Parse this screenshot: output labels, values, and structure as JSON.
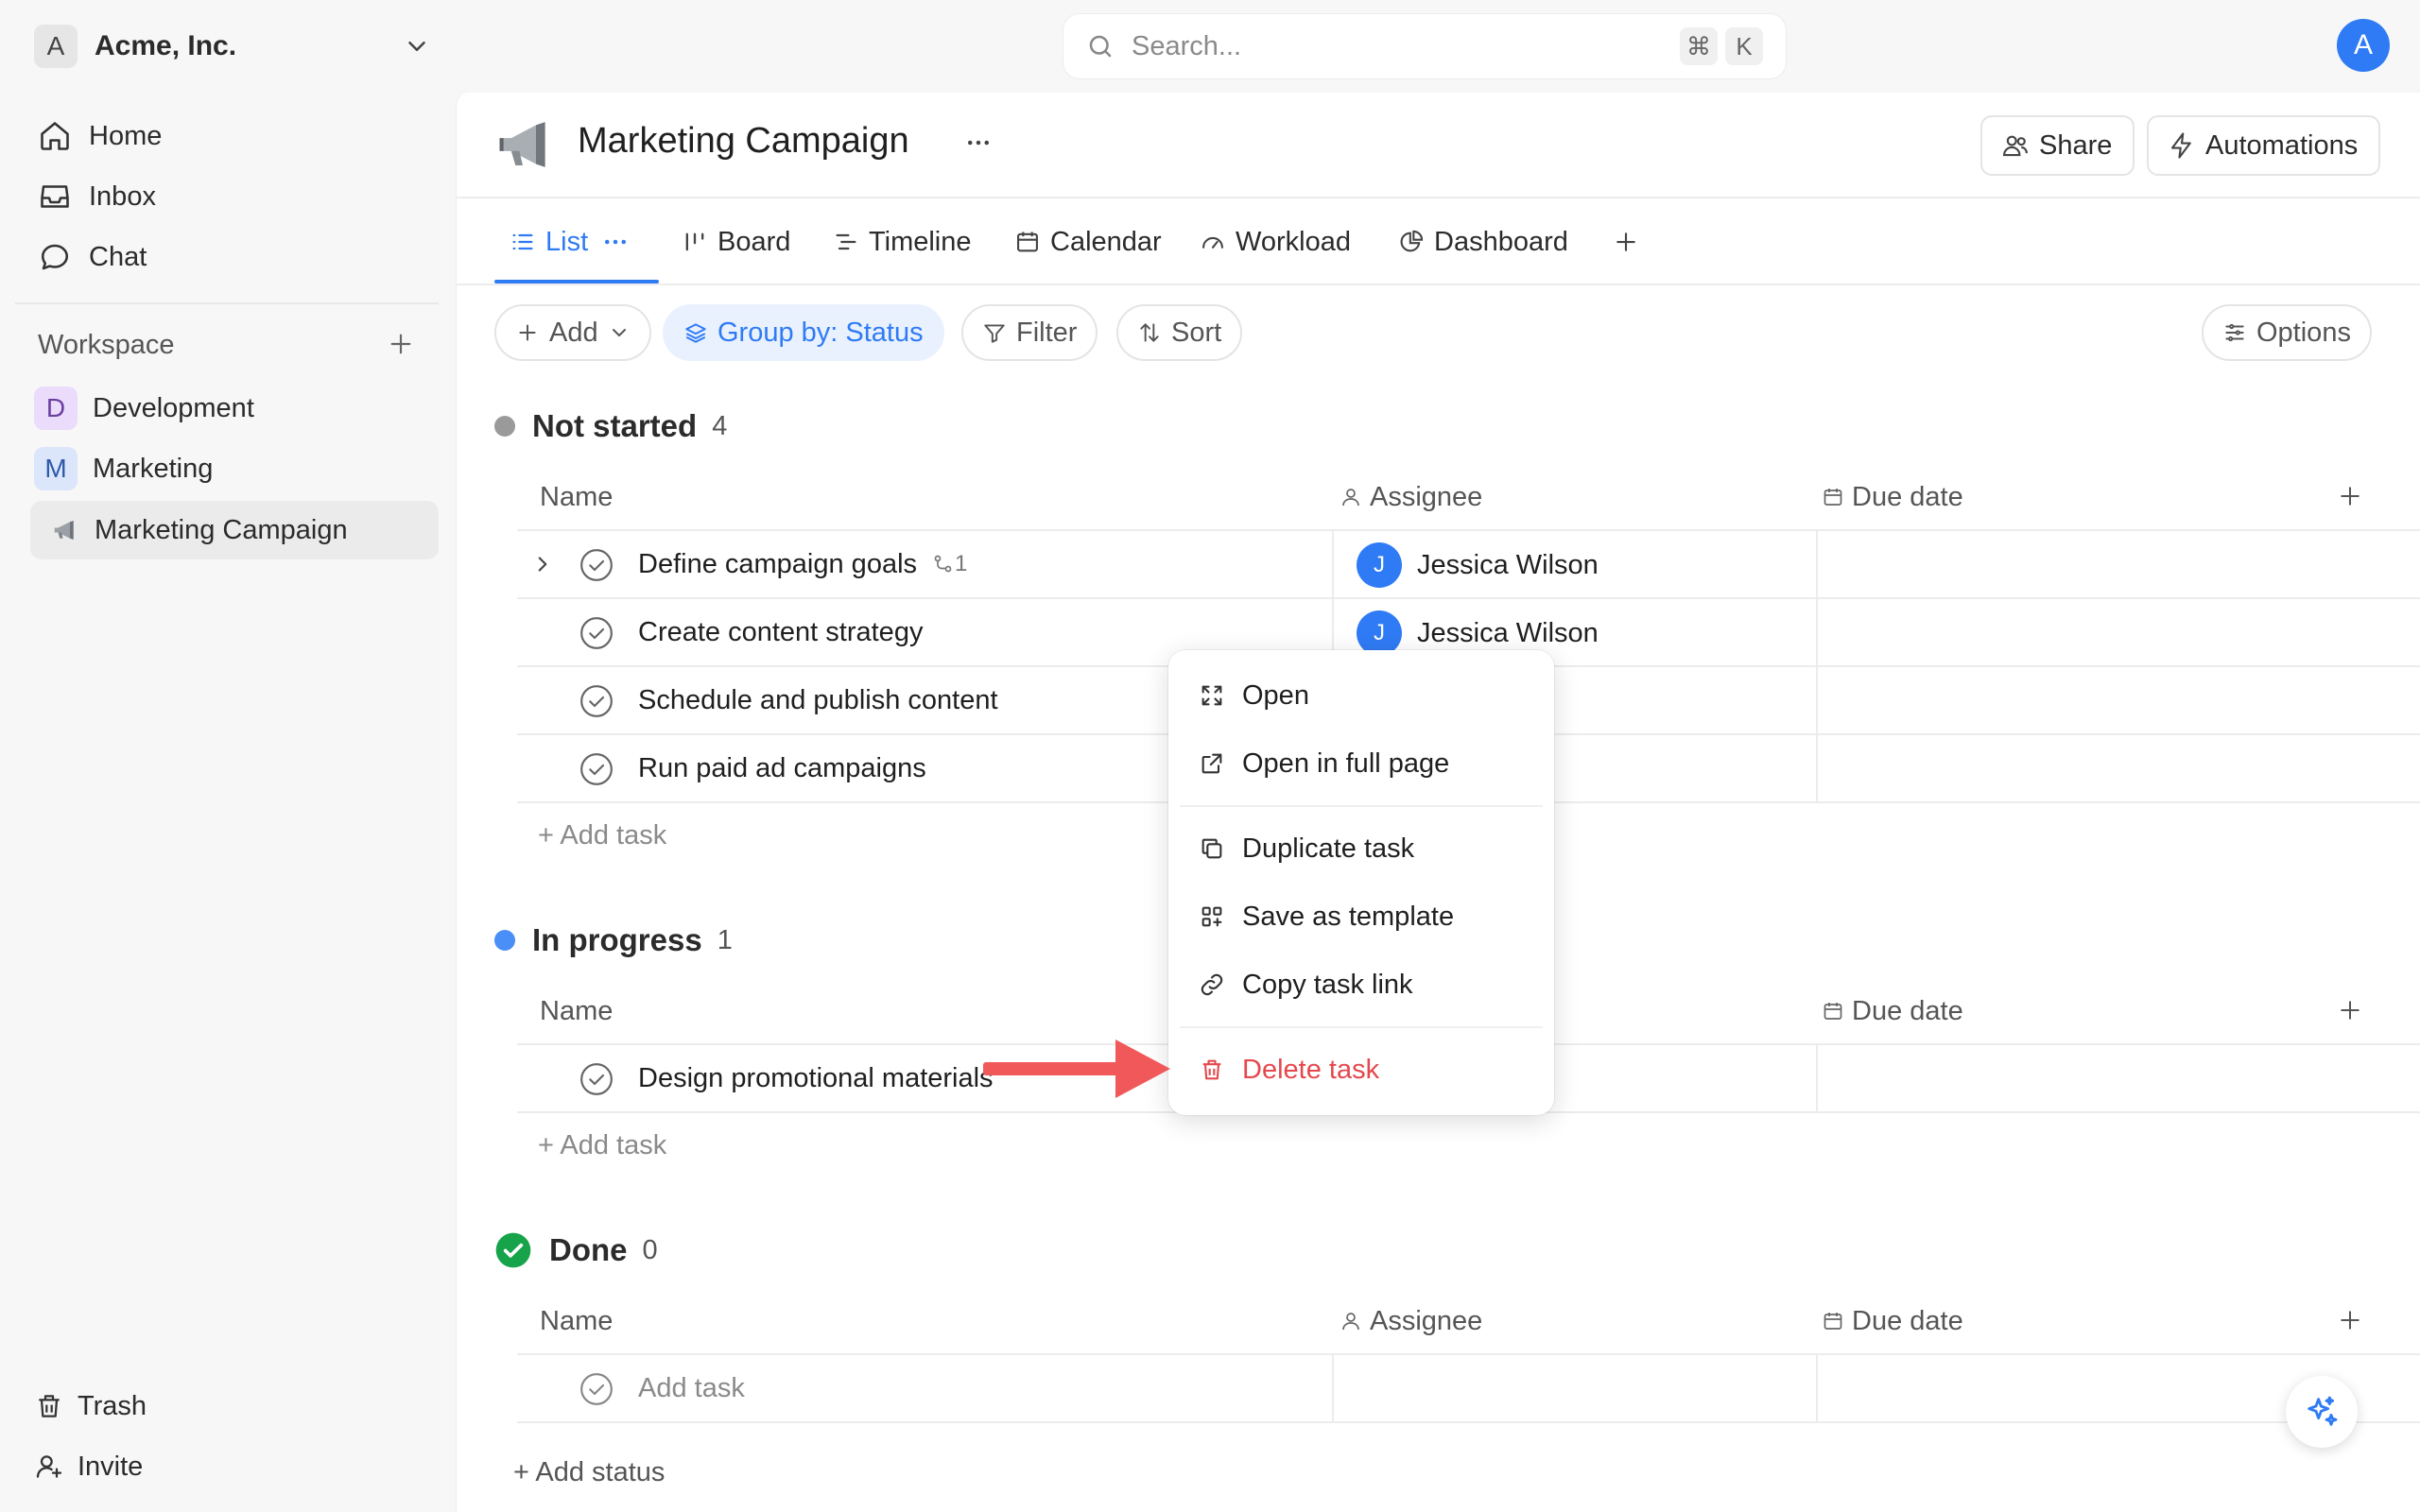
{
  "workspace_switcher": {
    "letter": "A",
    "name": "Acme, Inc."
  },
  "search": {
    "placeholder": "Search...",
    "shortcut_mod": "⌘",
    "shortcut_key": "K"
  },
  "user": {
    "initial": "A"
  },
  "sidebar": {
    "nav": [
      {
        "label": "Home"
      },
      {
        "label": "Inbox"
      },
      {
        "label": "Chat"
      }
    ],
    "workspace_heading": "Workspace",
    "projects": [
      {
        "letter": "D",
        "label": "Development"
      },
      {
        "letter": "M",
        "label": "Marketing"
      },
      {
        "label": "Marketing Campaign"
      }
    ],
    "bottom": [
      {
        "label": "Trash"
      },
      {
        "label": "Invite"
      }
    ]
  },
  "header": {
    "title": "Marketing Campaign",
    "share_label": "Share",
    "automations_label": "Automations"
  },
  "tabs": [
    {
      "label": "List"
    },
    {
      "label": "Board"
    },
    {
      "label": "Timeline"
    },
    {
      "label": "Calendar"
    },
    {
      "label": "Workload"
    },
    {
      "label": "Dashboard"
    }
  ],
  "toolbar": {
    "add_label": "Add",
    "group_label": "Group by: Status",
    "filter_label": "Filter",
    "sort_label": "Sort",
    "options_label": "Options"
  },
  "columns": {
    "name": "Name",
    "assignee": "Assignee",
    "due_date": "Due date"
  },
  "groups": [
    {
      "title": "Not started",
      "count": "4",
      "color": "#9a9a9a",
      "tasks": [
        {
          "name": "Define campaign goals",
          "subtasks": "1",
          "assignee": "Jessica Wilson",
          "assignee_initial": "J"
        },
        {
          "name": "Create content strategy",
          "assignee": "Jessica Wilson",
          "assignee_initial": "J"
        },
        {
          "name": "Schedule and publish content"
        },
        {
          "name": "Run paid ad campaigns"
        }
      ],
      "add_task": "+ Add task"
    },
    {
      "title": "In progress",
      "count": "1",
      "color": "#4a8ef7",
      "tasks": [
        {
          "name": "Design promotional materials"
        }
      ],
      "add_task": "+ Add task"
    },
    {
      "title": "Done",
      "count": "0",
      "color": "#16a34a",
      "tasks": [],
      "add_task_placeholder": "Add task"
    }
  ],
  "add_status": "+ Add status",
  "context_menu": {
    "items": [
      {
        "label": "Open",
        "icon": "expand-icon"
      },
      {
        "label": "Open in full page",
        "icon": "external-link-icon"
      },
      {
        "label": "Duplicate task",
        "icon": "copy-icon"
      },
      {
        "label": "Save as template",
        "icon": "template-icon"
      },
      {
        "label": "Copy task link",
        "icon": "link-icon"
      },
      {
        "label": "Delete task",
        "icon": "trash-icon",
        "color": "#e5484d"
      }
    ]
  },
  "colors": {
    "accent": "#2f7bf5",
    "danger": "#e5484d",
    "annotation_arrow": "#f0585a"
  }
}
